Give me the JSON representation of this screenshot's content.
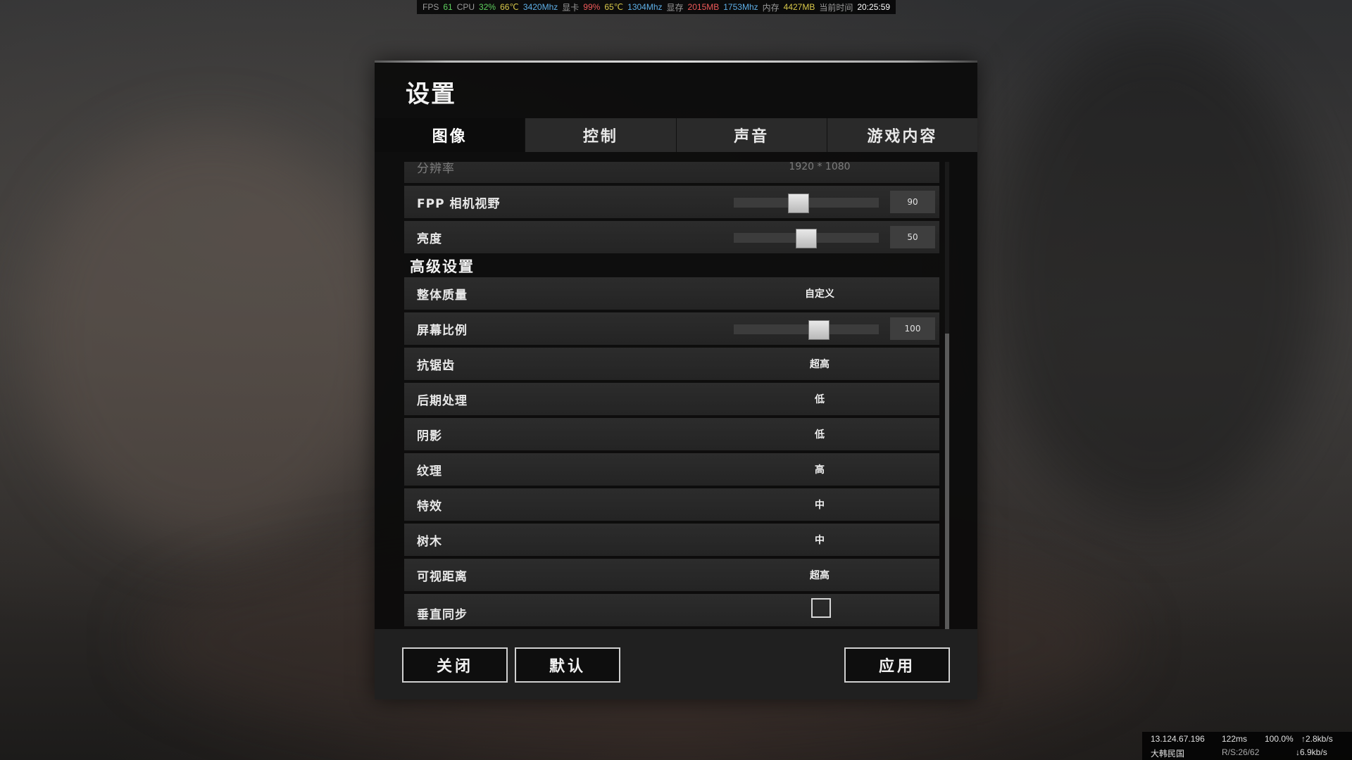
{
  "perf": {
    "fps_label": "FPS",
    "fps": "61",
    "cpu_label": "CPU",
    "cpu_usage": "32%",
    "cpu_temp": "66℃",
    "cpu_clock": "3420Mhz",
    "gpu_label": "显卡",
    "gpu_usage": "99%",
    "gpu_temp": "65℃",
    "gpu_clock": "1304Mhz",
    "vram_label": "显存",
    "vram_used": "2015MB",
    "vram_clock": "1753Mhz",
    "ram_label": "内存",
    "ram_used": "4427MB",
    "time_label": "当前时间",
    "time": "20:25:59"
  },
  "settings": {
    "title": "设置",
    "tabs": [
      {
        "label": "图像",
        "active": true
      },
      {
        "label": "控制",
        "active": false
      },
      {
        "label": "声音",
        "active": false
      },
      {
        "label": "游戏内容",
        "active": false
      }
    ],
    "basic_rows": {
      "resolution": {
        "label": "分辨率",
        "value": "1920 * 1080"
      },
      "fov": {
        "label": "FPP 相机视野",
        "value": "90",
        "level": 0.44
      },
      "brightness": {
        "label": "亮度",
        "value": "50",
        "level": 0.5
      }
    },
    "advanced_header": "高级设置",
    "advanced_rows": {
      "overall_quality": {
        "label": "整体质量",
        "value": "自定义"
      },
      "screen_scale": {
        "label": "屏幕比例",
        "value": "100",
        "level": 0.6
      },
      "anti_aliasing": {
        "label": "抗锯齿",
        "value": "超高"
      },
      "post_processing": {
        "label": "后期处理",
        "value": "低"
      },
      "shadows": {
        "label": "阴影",
        "value": "低"
      },
      "textures": {
        "label": "纹理",
        "value": "高"
      },
      "effects": {
        "label": "特效",
        "value": "中"
      },
      "foliage": {
        "label": "树木",
        "value": "中"
      },
      "view_distance": {
        "label": "可视距离",
        "value": "超高"
      },
      "vsync": {
        "label": "垂直同步",
        "checked": false
      }
    },
    "buttons": {
      "close": "关闭",
      "default": "默认",
      "apply": "应用"
    }
  },
  "net": {
    "ip": "13.124.67.196",
    "ping": "122ms",
    "pct": "100.0%",
    "upload": "↑2.8kb/s",
    "region": "大韩民国",
    "rs": "R/S:26/62",
    "download": "↓6.9kb/s"
  },
  "colors": {
    "green": "#5fd15f",
    "yellow": "#d9c94a",
    "blue": "#5fb0e8",
    "red": "#f05a5a",
    "panel_bg": "#0a0a0a",
    "row_bg": "#2a2a2a"
  }
}
